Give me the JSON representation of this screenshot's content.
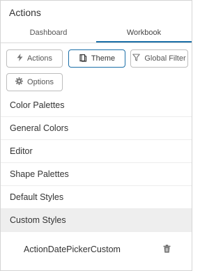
{
  "panel": {
    "title": "Actions"
  },
  "tabs": [
    {
      "label": "Dashboard",
      "active": false
    },
    {
      "label": "Workbook",
      "active": true
    }
  ],
  "toolbar": {
    "actions_label": "Actions",
    "theme_label": "Theme",
    "global_filter_label": "Global Filter",
    "options_label": "Options"
  },
  "sections": [
    {
      "label": "Color Palettes"
    },
    {
      "label": "General Colors"
    },
    {
      "label": "Editor"
    },
    {
      "label": "Shape Palettes"
    },
    {
      "label": "Default Styles"
    },
    {
      "label": "Custom Styles",
      "selected": true
    }
  ],
  "custom_styles": {
    "items": [
      {
        "label": "ActionDatePickerCustom"
      }
    ]
  },
  "colors": {
    "accent": "#1b6fa8",
    "selected_row": "#eeeeee",
    "border": "#bdbdbd"
  }
}
